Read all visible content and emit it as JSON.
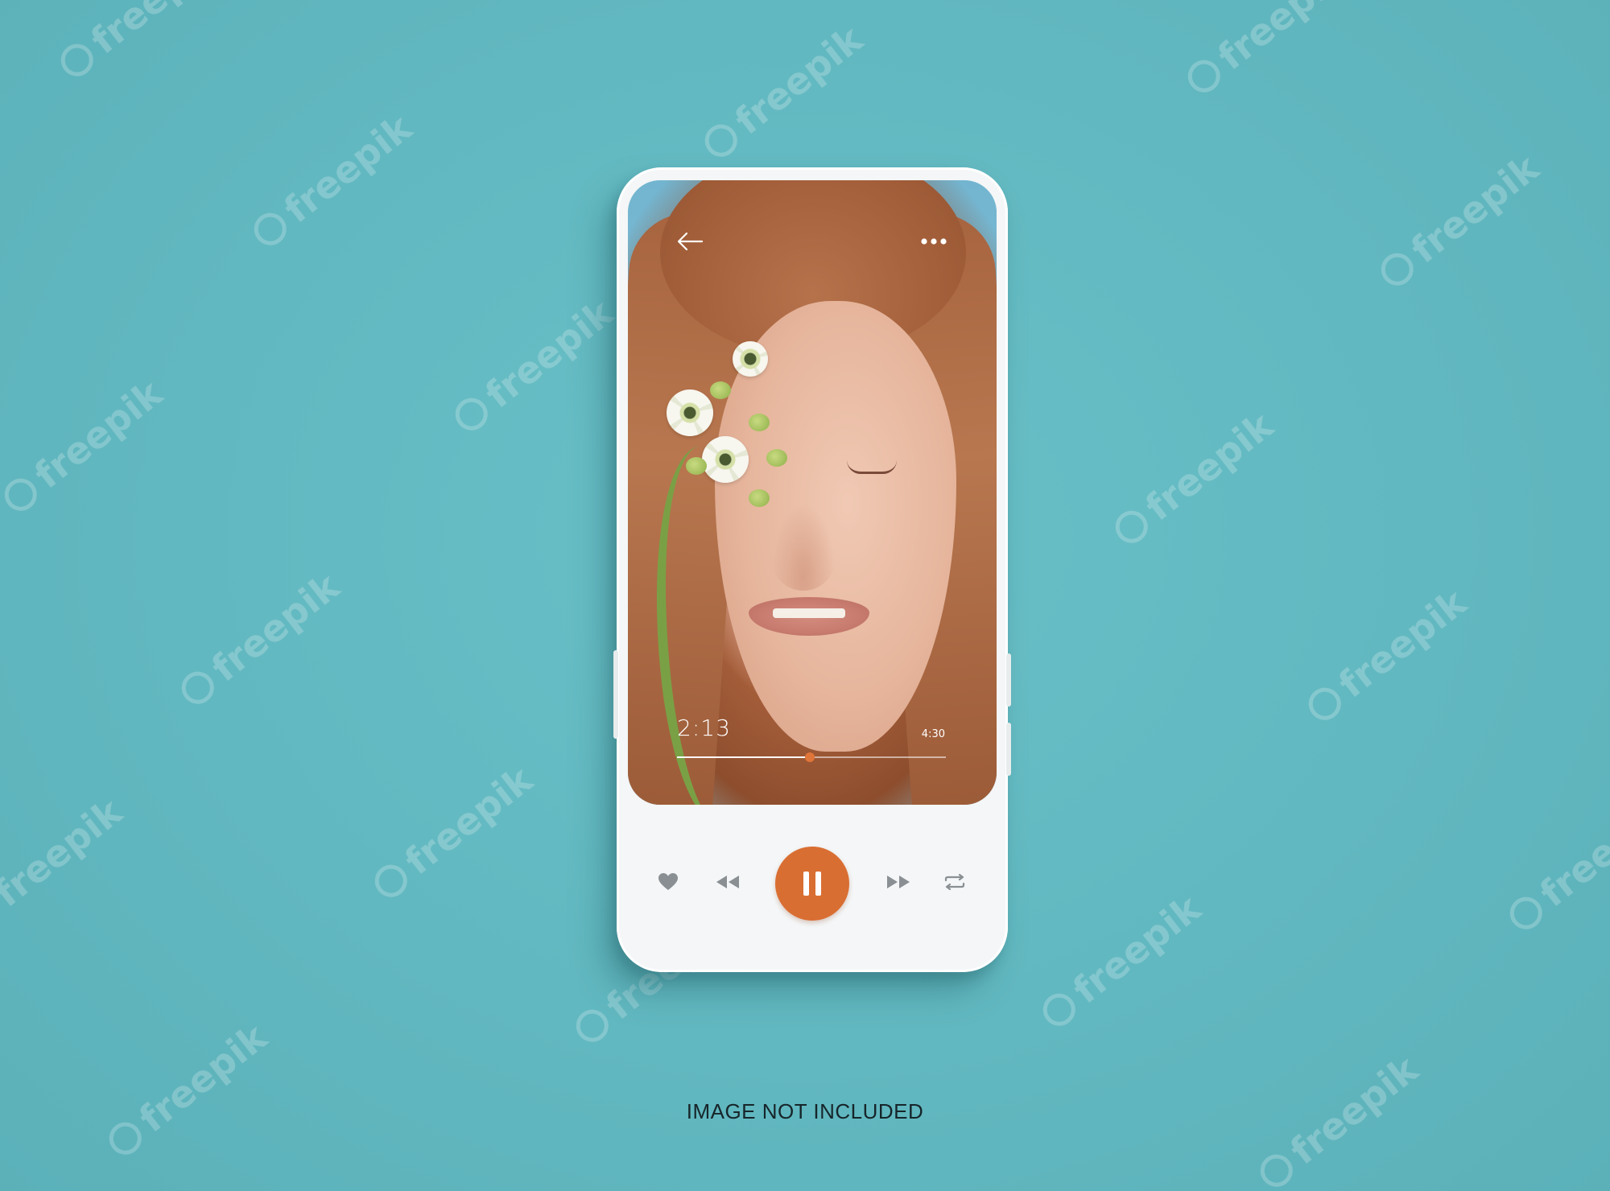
{
  "watermark": {
    "text": "freepik"
  },
  "player": {
    "current_time": "2:13",
    "total_time": "4:30",
    "progress": 0.493
  },
  "icons": {
    "back": "back-arrow-icon",
    "more": "more-options-icon",
    "like": "heart-icon",
    "previous": "rewind-icon",
    "play_state": "pause-icon",
    "next": "fast-forward-icon",
    "repeat": "repeat-icon"
  },
  "colors": {
    "background": "#63b9c1",
    "accent": "#d96e32",
    "phone_body": "#f4f6f7",
    "icon_gray": "#8a8f93"
  },
  "caption": "IMAGE NOT INCLUDED"
}
